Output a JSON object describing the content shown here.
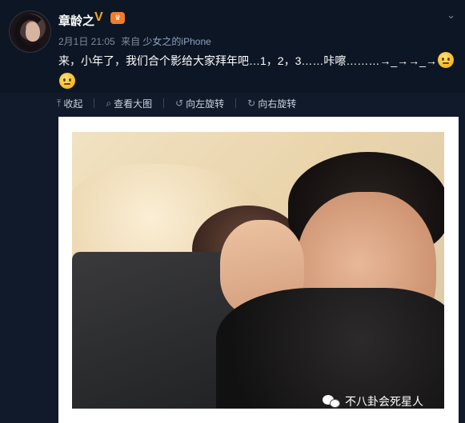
{
  "post": {
    "username": "章龄之",
    "verified_icon": "V",
    "member_badge_icon": "vip-badge-icon",
    "time": "2月1日 21:05",
    "source_prefix": "来自",
    "source_name": "少女之的iPhone",
    "text": "来，小年了，我们合个影给大家拜年吧…1，2，3……咔嚓………→_→→_→",
    "emoji_icon": "confused-face-icon"
  },
  "toolbar": {
    "collapse": "收起",
    "view_large": "查看大图",
    "rotate_left": "向左旋转",
    "rotate_right": "向右旋转"
  },
  "watermark": {
    "text": "不八卦会死星人"
  },
  "colors": {
    "background": "#0d1624",
    "media_background": "#111a2a",
    "meta_text": "#7f8a9c",
    "verified": "#f5a623",
    "member": "#f07b2a"
  }
}
